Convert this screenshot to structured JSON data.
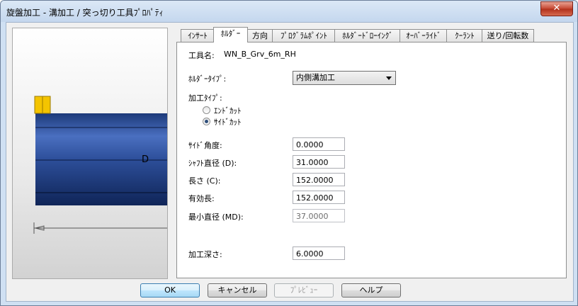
{
  "window": {
    "title": "旋盤加工 - 溝加工 / 突っ切り工具ﾌﾟﾛﾊﾟﾃｨ",
    "close_label": "✕"
  },
  "preview": {
    "dimension_label": "D"
  },
  "tabs": [
    {
      "label": "ｲﾝｻｰﾄ",
      "active": false
    },
    {
      "label": "ﾎﾙﾀﾞｰ",
      "active": true
    },
    {
      "label": "方向",
      "active": false
    },
    {
      "label": "ﾌﾟﾛｸﾞﾗﾑﾎﾟｲﾝﾄ",
      "active": false
    },
    {
      "label": "ﾎﾙﾀﾞｰﾄﾞﾛｰｲﾝｸﾞ",
      "active": false
    },
    {
      "label": "ｵｰﾊﾞｰﾗｲﾄﾞ",
      "active": false
    },
    {
      "label": "ｸｰﾗﾝﾄ",
      "active": false
    },
    {
      "label": "送り/回転数",
      "active": false
    }
  ],
  "holder": {
    "tool_name_label": "工具名:",
    "tool_name_value": "WN_B_Grv_6m_RH",
    "holder_type_label": "ﾎﾙﾀﾞｰﾀｲﾌﾟ:",
    "holder_type_value": "内側溝加工",
    "machining_type_label": "加工ﾀｲﾌﾟ:",
    "radio_end_cut": "ｴﾝﾄﾞｶｯﾄ",
    "radio_side_cut": "ｻｲﾄﾞｶｯﾄ",
    "side_angle_label": "ｻｲﾄﾞ角度:",
    "side_angle_value": "0.0000",
    "shaft_dia_label": "ｼｬﾌﾄ直径 (D):",
    "shaft_dia_value": "31.0000",
    "length_label": "長さ (C):",
    "length_value": "152.0000",
    "effective_length_label": "有効長:",
    "effective_length_value": "152.0000",
    "min_dia_label": "最小直径 (MD):",
    "min_dia_value": "37.0000",
    "cut_depth_label": "加工深さ:",
    "cut_depth_value": "6.0000"
  },
  "buttons": {
    "ok": "OK",
    "cancel": "キャンセル",
    "preview": "ﾌﾟﾚﾋﾞｭｰ",
    "help": "ヘルプ"
  }
}
